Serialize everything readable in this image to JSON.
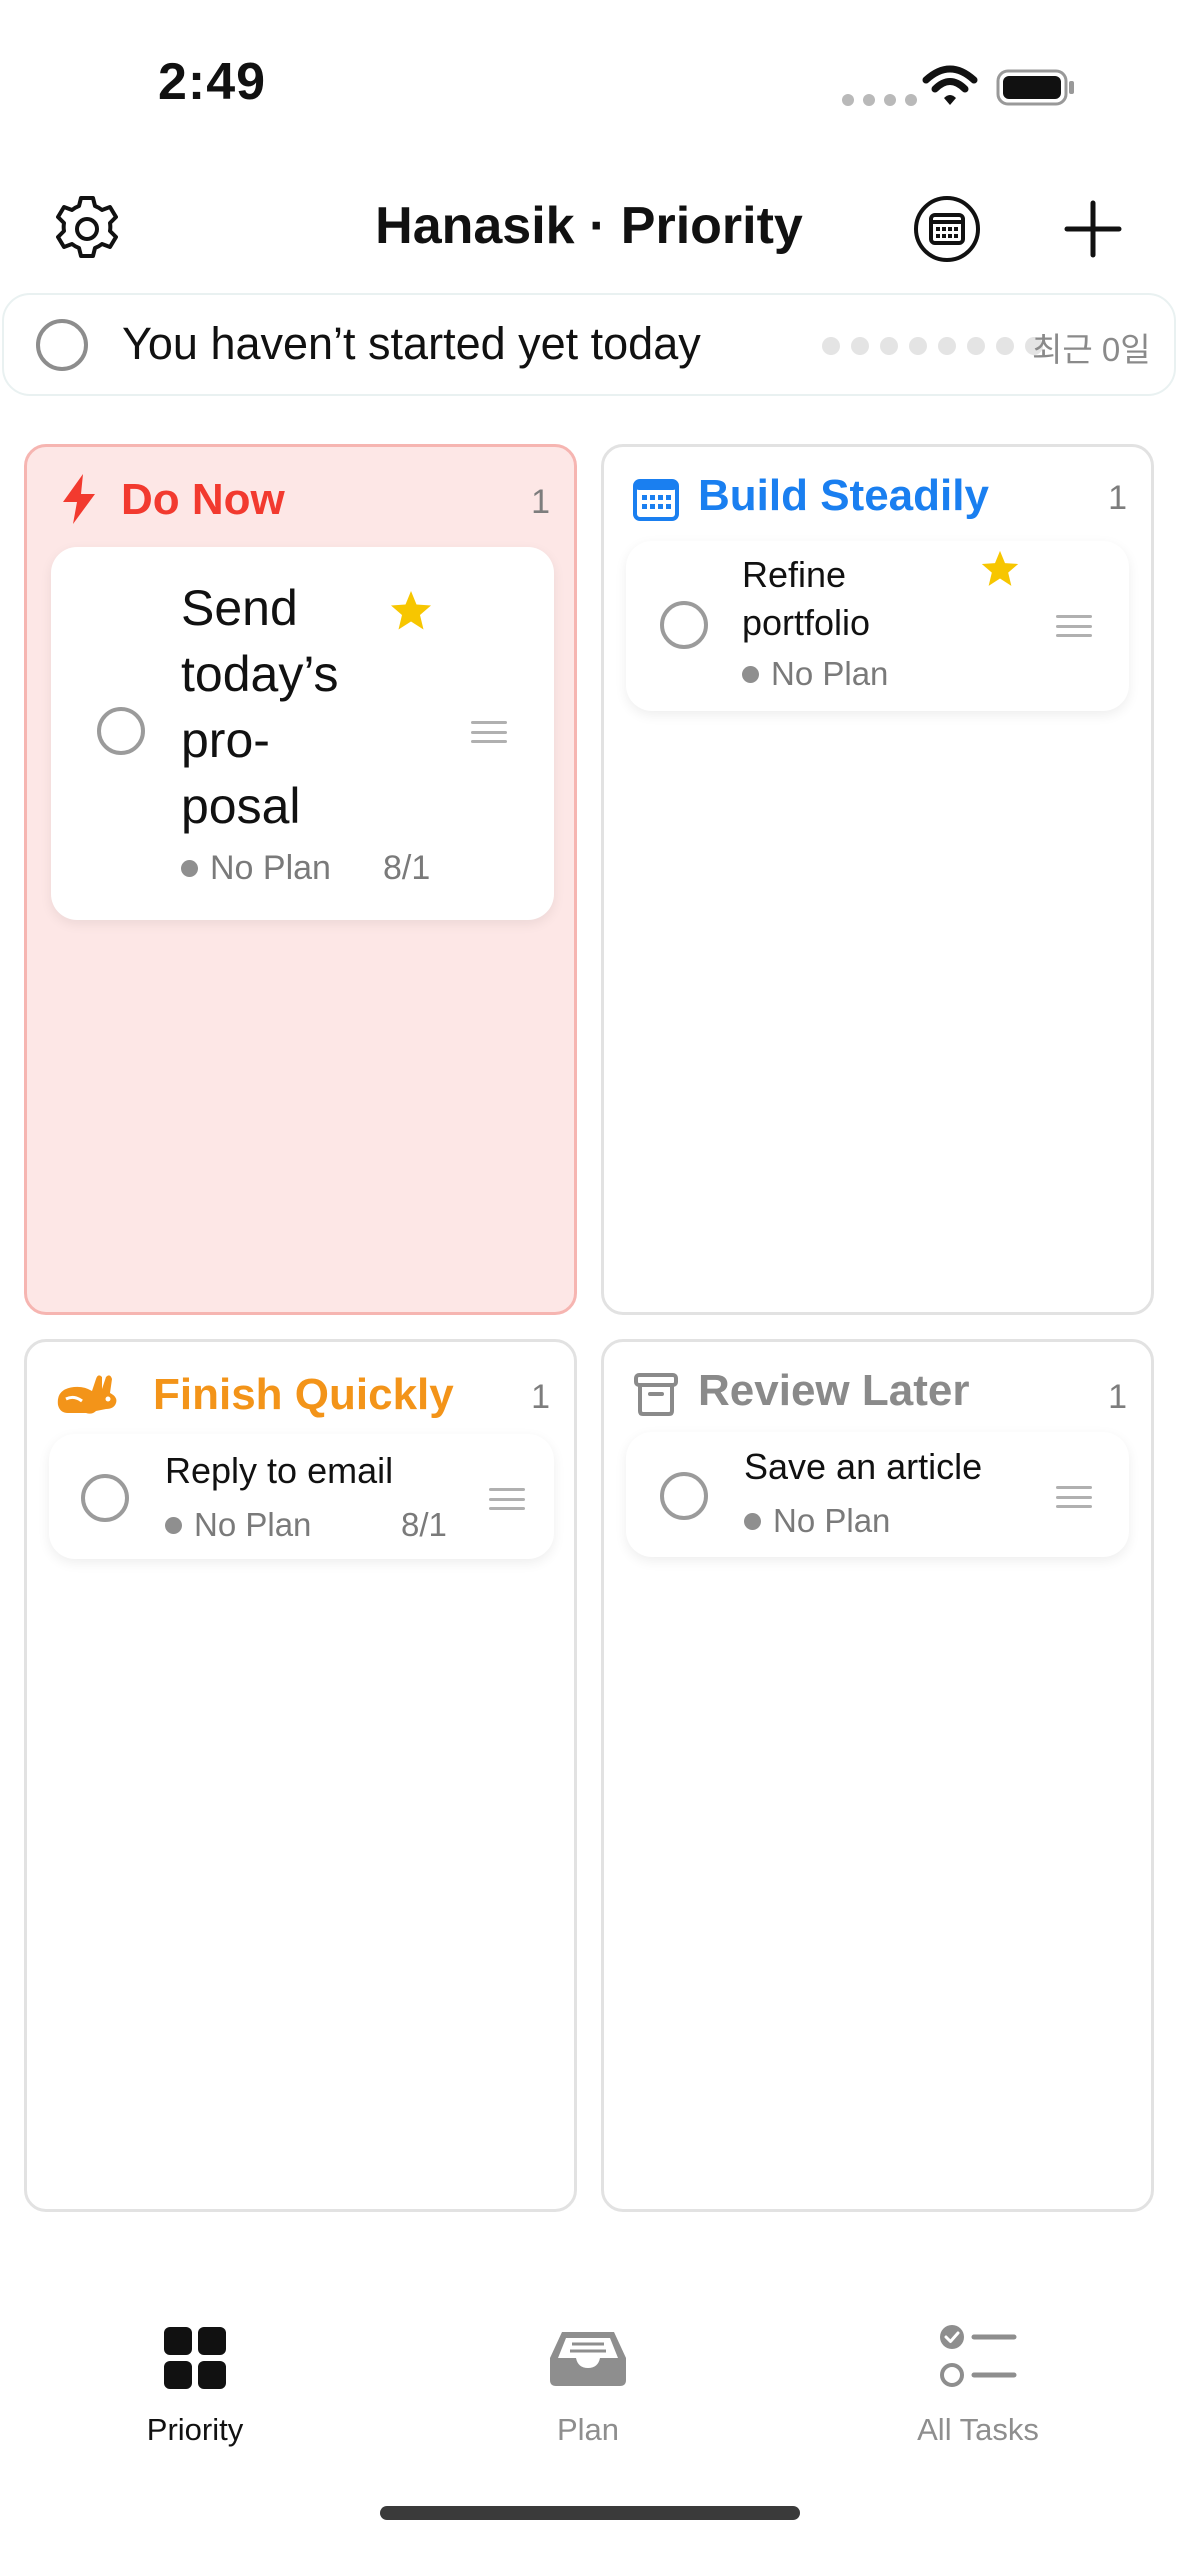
{
  "status_bar": {
    "time": "2:49"
  },
  "header": {
    "title": "Hanasik · Priority"
  },
  "banner": {
    "text": "You haven’t started yet today",
    "streak": "최근 0일"
  },
  "quadrants": {
    "now": {
      "title": "Do Now",
      "count": "1",
      "color": "#f23a2f",
      "task": {
        "line1": "Send",
        "line2": "today’s",
        "line3": "pro-",
        "line4": "posal",
        "plan": "No Plan",
        "date": "8/1"
      }
    },
    "build": {
      "title": "Build Steadily",
      "count": "1",
      "color": "#1a7ff0",
      "task": {
        "line1": "Refine",
        "line2": "portfolio",
        "plan": "No Plan"
      }
    },
    "quick": {
      "title": "Finish Quickly",
      "count": "1",
      "color": "#f39419",
      "task": {
        "line1": "Reply to email",
        "plan": "No Plan",
        "date": "8/1"
      }
    },
    "later": {
      "title": "Review Later",
      "count": "1",
      "color": "#8a8a8a",
      "task": {
        "line1": "Save an article",
        "plan": "No Plan"
      }
    }
  },
  "tabs": [
    {
      "label": "Priority",
      "icon": "grid-icon",
      "active": true
    },
    {
      "label": "Plan",
      "icon": "inbox-icon",
      "active": false
    },
    {
      "label": "All Tasks",
      "icon": "checklist-icon",
      "active": false
    }
  ],
  "colors": {
    "star": "#f7c600",
    "active_tab": "#111111",
    "inactive_tab": "#8e8e8e"
  }
}
